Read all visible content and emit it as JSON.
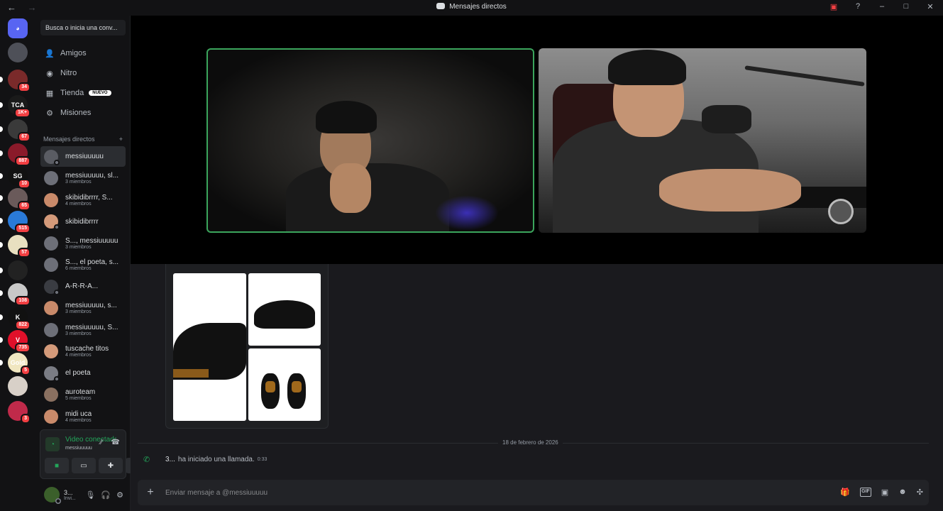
{
  "window": {
    "title": "Mensajes directos",
    "nav_back": "←",
    "nav_forward": "→",
    "controls": [
      "inbox-icon",
      "help-icon",
      "minimize-icon",
      "maximize-icon",
      "close-icon"
    ]
  },
  "servers": [
    {
      "label": "",
      "badge": "",
      "color": "#5865f2",
      "icon": "discord-logo-icon"
    },
    {
      "label": "",
      "badge": "",
      "color": "#4e5058"
    },
    {
      "label": "",
      "badge": "34",
      "color": "#7a2a2a"
    },
    {
      "label": "TCA",
      "badge": "1K+",
      "color": "#1a1a1a"
    },
    {
      "label": "",
      "badge": "67",
      "color": "#3a3a3a"
    },
    {
      "label": "",
      "badge": "887",
      "color": "#8a1a2a"
    },
    {
      "label": "SG",
      "badge": "10",
      "color": "#111111"
    },
    {
      "label": "",
      "badge": "65",
      "color": "#6a5a5a"
    },
    {
      "label": "",
      "badge": "515",
      "color": "#2a7ad8"
    },
    {
      "label": "",
      "badge": "57",
      "color": "#e8e0c0"
    },
    {
      "label": "",
      "badge": "",
      "color": "#222222"
    },
    {
      "label": "",
      "badge": "108",
      "color": "#c8c8c8"
    },
    {
      "label": "K",
      "badge": "822",
      "color": "#111111"
    },
    {
      "label": "V",
      "badge": "735",
      "color": "#e0102a"
    },
    {
      "label": "Gold",
      "badge": "5",
      "color": "#f0e6c0"
    },
    {
      "label": "",
      "badge": "",
      "color": "#d8d0c8"
    },
    {
      "label": "",
      "badge": "3",
      "color": "#c02a4a"
    }
  ],
  "sidebar": {
    "search_placeholder": "Busca o inicia una conv...",
    "nav": [
      {
        "label": "Amigos",
        "icon": "friends-icon",
        "glyph": "👤"
      },
      {
        "label": "Nitro",
        "icon": "nitro-icon",
        "glyph": "◉"
      },
      {
        "label": "Tienda",
        "icon": "shop-icon",
        "glyph": "▦",
        "badge": "NUEVO"
      },
      {
        "label": "Misiones",
        "icon": "quests-icon",
        "glyph": "⚙"
      }
    ],
    "dm_header": "Mensajes directos",
    "dm_add": "+",
    "dms": [
      {
        "name": "messiuuuuu",
        "sub": "",
        "active": true
      },
      {
        "name": "messiuuuuu, sl...",
        "sub": "3 miembros"
      },
      {
        "name": "skibidibrrrr, S...",
        "sub": "4 miembros"
      },
      {
        "name": "skibidibrrrr",
        "sub": ""
      },
      {
        "name": "S..., messiuuuuu",
        "sub": "3 miembros"
      },
      {
        "name": "S..., el poeta, s...",
        "sub": "6 miembros"
      },
      {
        "name": "A-R-R-A...",
        "sub": ""
      },
      {
        "name": "messiuuuuu, s...",
        "sub": "3 miembros"
      },
      {
        "name": "messiuuuuu, S...",
        "sub": "3 miembros"
      },
      {
        "name": "tuscache titos",
        "sub": "4 miembros"
      },
      {
        "name": "el poeta",
        "sub": ""
      },
      {
        "name": "auroteam",
        "sub": "5 miembros"
      },
      {
        "name": "midi uca",
        "sub": "4 miembros"
      }
    ]
  },
  "voice": {
    "status": "Video conectado",
    "channel": "messiuuuuu"
  },
  "user": {
    "name": "3...",
    "status": "Invi..."
  },
  "chat": {
    "date_separator": "18 de febrero de 2026",
    "call_user": "3...",
    "call_text": "ha iniciado una llamada.",
    "call_time": "0:33",
    "composer_placeholder": "Enviar mensaje a @messiuuuuu",
    "gif_label": "GIF"
  }
}
